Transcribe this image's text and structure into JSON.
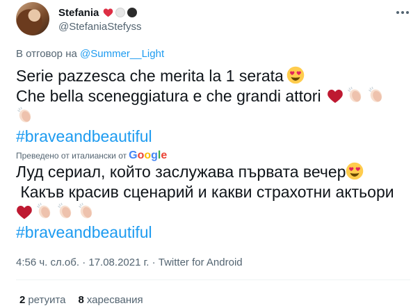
{
  "author": {
    "display_name": "Stefania",
    "handle": "@StefaniaStefyss",
    "name_emojis": [
      "red-heart",
      "white-circle",
      "black-circle"
    ]
  },
  "reply": {
    "prefix": "В отговор на",
    "to": "@Summer__Light"
  },
  "tweet": {
    "line1": "Serie pazzesca che merita la 1 serata",
    "line2": "Che bella sceneggiatura e che grandi attori",
    "hashtag": "#braveandbeautiful"
  },
  "translation": {
    "label": "Преведено от италиански от",
    "provider": "Google",
    "line1": "Луд сериал, който заслужава първата вечер",
    "line2": " Какъв красив сценарий и какви страхотни актьори",
    "hashtag": "#braveandbeautiful"
  },
  "meta": {
    "text": "4:56 ч. сл.об. · 17.08.2021 г. · Twitter for Android"
  },
  "stats": {
    "retweets_count": "2",
    "retweets_label": "ретуита",
    "likes_count": "8",
    "likes_label": "харесвания"
  },
  "colors": {
    "accent": "#1d9bf0",
    "text": "#0f1419",
    "secondary": "#536471"
  }
}
